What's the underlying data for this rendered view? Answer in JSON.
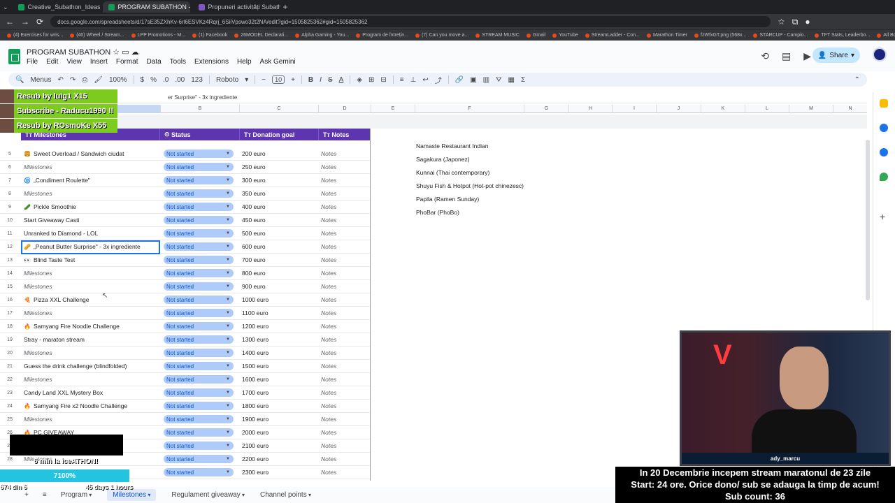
{
  "browser": {
    "tabs": [
      {
        "label": "Creative_Subathon_Ideas.xlsx",
        "color": "#0f9d58"
      },
      {
        "label": "PROGRAM SUBATHON - Goog",
        "color": "#0f9d58",
        "active": true
      },
      {
        "label": "Propuneri activități Subathon",
        "color": "#7e57c2"
      }
    ],
    "url": "docs.google.com/spreadsheets/d/17sE35ZXhKv-6rl6ESVKz4Rqrj_6SiiVpswo32t2NA/edit?gid=1505825362#gid=1505825362",
    "bookmarks": [
      "(4) Exercises for wris...",
      "(40) Wheel / Stream...",
      "LPP Promotions - M...",
      "(1) Facebook",
      "26MODEL Declarati...",
      "Alpha Gaming - You...",
      "Program de întrețin...",
      "(7) Can you move a...",
      "STREAM MUSIC",
      "Gmail",
      "YouTube",
      "StreamLadder - Con...",
      "Marathon Timer",
      "fzWfxGT.png (568x...",
      "STARCUP - Campio...",
      "TFT Stats, Leaderbo...",
      "All Bookmarks"
    ]
  },
  "doc": {
    "title": "PROGRAM SUBATHON",
    "menus": [
      "File",
      "Edit",
      "View",
      "Insert",
      "Format",
      "Data",
      "Tools",
      "Extensions",
      "Help",
      "Ask Gemini"
    ],
    "share_label": "Share"
  },
  "toolbar": {
    "menus_label": "Menus",
    "zoom": "100%",
    "currency": "$",
    "percent": "%",
    "dec_dec": ".0",
    "dec_inc": ".00",
    "number_format": "123",
    "font": "Roboto",
    "font_size": "10"
  },
  "formula": {
    "content": "er Surprise\" - 3x ingrediente"
  },
  "columns": [
    "A",
    "B",
    "C",
    "D",
    "E",
    "F",
    "G",
    "H",
    "I",
    "J",
    "K",
    "L",
    "M",
    "N"
  ],
  "table": {
    "headers": {
      "milestones": "Milestones",
      "status": "Status",
      "goal": "Donation goal",
      "notes": "Notes"
    },
    "rows": [
      {
        "n": "5",
        "name": "Sweet Overload / Sandwich ciudat",
        "icon": "🍔",
        "status": "Not started",
        "goal": "200 euro",
        "notes": "Notes"
      },
      {
        "n": "6",
        "name": "Milestones",
        "italic": true,
        "status": "Not started",
        "goal": "250 euro",
        "notes": "Notes"
      },
      {
        "n": "7",
        "name": "„Condiment Roulette\"",
        "icon": "🌀",
        "status": "Not started",
        "goal": "300 euro",
        "notes": "Notes"
      },
      {
        "n": "8",
        "name": "Milestones",
        "italic": true,
        "status": "Not started",
        "goal": "350 euro",
        "notes": "Notes"
      },
      {
        "n": "9",
        "name": "Pickle Smoothie",
        "icon": "🥒",
        "status": "Not started",
        "goal": "400 euro",
        "notes": "Notes"
      },
      {
        "n": "10",
        "name": "Start Giveaway Casti",
        "status": "Not started",
        "goal": "450 euro",
        "notes": "Notes"
      },
      {
        "n": "11",
        "name": "Unranked to Diamond - LOL",
        "status": "Not started",
        "goal": "500 euro",
        "notes": "Notes"
      },
      {
        "n": "12",
        "name": "„Peanut Butter Surprise\" - 3x ingrediente",
        "icon": "🥜",
        "status": "Not started",
        "goal": "600 euro",
        "notes": "Notes"
      },
      {
        "n": "13",
        "name": "Blind Taste Test",
        "icon": "👀",
        "status": "Not started",
        "goal": "700 euro",
        "notes": "Notes"
      },
      {
        "n": "14",
        "name": "Milestones",
        "italic": true,
        "status": "Not started",
        "goal": "800 euro",
        "notes": "Notes"
      },
      {
        "n": "15",
        "name": "Milestones",
        "italic": true,
        "status": "Not started",
        "goal": "900 euro",
        "notes": "Notes"
      },
      {
        "n": "16",
        "name": "Pizza XXL Challenge",
        "icon": "🍕",
        "status": "Not started",
        "goal": "1000 euro",
        "notes": "Notes"
      },
      {
        "n": "17",
        "name": "Milestones",
        "italic": true,
        "status": "Not started",
        "goal": "1100 euro",
        "notes": "Notes"
      },
      {
        "n": "18",
        "name": "Samyang Fire Noodle Challenge",
        "icon": "🔥",
        "status": "Not started",
        "goal": "1200 euro",
        "notes": "Notes"
      },
      {
        "n": "19",
        "name": "Stray - maraton stream",
        "status": "Not started",
        "goal": "1300 euro",
        "notes": "Notes"
      },
      {
        "n": "20",
        "name": "Milestones",
        "italic": true,
        "status": "Not started",
        "goal": "1400 euro",
        "notes": "Notes"
      },
      {
        "n": "21",
        "name": "Guess the drink challenge (blindfolded)",
        "status": "Not started",
        "goal": "1500 euro",
        "notes": "Notes"
      },
      {
        "n": "22",
        "name": "Milestones",
        "italic": true,
        "status": "Not started",
        "goal": "1600 euro",
        "notes": "Notes"
      },
      {
        "n": "23",
        "name": "Candy Land XXL Mystery Box",
        "status": "Not started",
        "goal": "1700 euro",
        "notes": "Notes"
      },
      {
        "n": "24",
        "name": "Samyang Fire x2 Noodle Challenge",
        "icon": "🔥",
        "status": "Not started",
        "goal": "1800 euro",
        "notes": "Notes"
      },
      {
        "n": "25",
        "name": "Milestones",
        "italic": true,
        "status": "Not started",
        "goal": "1900 euro",
        "notes": "Notes"
      },
      {
        "n": "26",
        "name": "PC GIVEAWAY",
        "icon": "🔥",
        "status": "Not started",
        "goal": "2000 euro",
        "notes": "Notes"
      },
      {
        "n": "27",
        "name": "",
        "status": "Not started",
        "goal": "2100 euro",
        "notes": "Notes"
      },
      {
        "n": "28",
        "name": "Milestones",
        "italic": true,
        "status": "Not started",
        "goal": "2200 euro",
        "notes": "Notes"
      },
      {
        "n": "29",
        "name": "",
        "status": "Not started",
        "goal": "2300 euro",
        "notes": "Notes"
      }
    ]
  },
  "restaurants": [
    "Namaste Restaurant Indian",
    "Sagakura (Japonez)",
    "Kunnai (Thai contemporary)",
    "Shuyu Fish & Hotpot (Hot-pot chinezesc)",
    "Papila (Ramen Sunday)",
    "PhoBar (PhoBo)"
  ],
  "sheets": [
    "Program",
    "Milestones",
    "Regulament giveaway",
    "Channel points"
  ],
  "overlay": {
    "alerts": [
      "Resub by luig1 X15",
      "Subscribe - Raducu1990 !!",
      "Resub by ROsmoKe X55"
    ],
    "timer_label": "6 min la iceATHON!",
    "progress_label": "7100%",
    "progress_fraction": 1,
    "sub_counter": "674 din 6",
    "days_label": "45 days 1 hours",
    "camera_name": "ady_marcu",
    "announcement": [
      "In 20 Decembrie incepem stream maratonul de 23 zile",
      "Start: 24 ore. Orice dono/ sub se adauga la timp de acum!",
      "Sub count: 36"
    ]
  }
}
